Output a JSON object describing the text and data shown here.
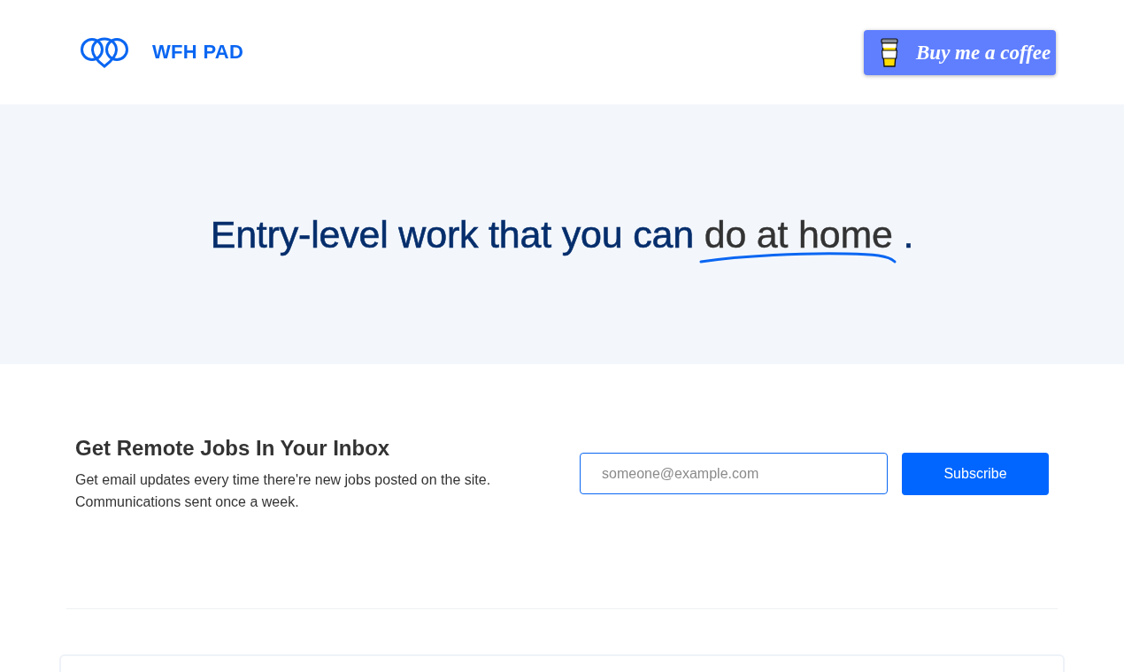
{
  "header": {
    "logo_text": "WFH PAD",
    "coffee_button": "Buy me a coffee"
  },
  "hero": {
    "title": "Entry-level work that you can",
    "highlight": "do at home",
    "title_end": "."
  },
  "subscribe": {
    "heading": "Get Remote Jobs In Your Inbox",
    "description": "Get email updates every time there're new jobs posted on the site. Communications sent once a week.",
    "email_field": {
      "placeholder": "someone@example.com"
    },
    "button": "Subscribe"
  }
}
